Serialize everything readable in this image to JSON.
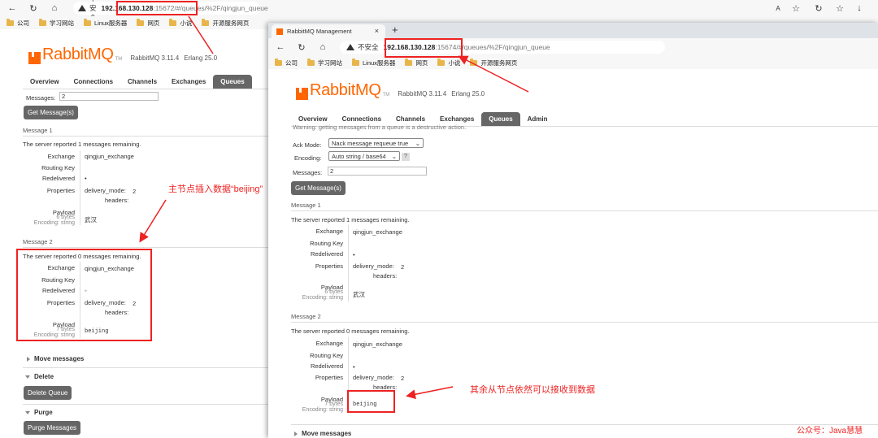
{
  "back_window": {
    "address": {
      "warning": "不安全",
      "host": "192.168.130.128",
      "port": ":15672",
      "path": "/#/queues/%2F/qingjun_queue"
    },
    "bookmarks": [
      "公司",
      "学习网站",
      "Linux服务器",
      "网页",
      "小说",
      "开源服务网页"
    ],
    "logo": {
      "text": "RabbitMQ",
      "tm": "TM",
      "version": "RabbitMQ 3.11.4",
      "erlang": "Erlang 25.0"
    },
    "tabs": [
      "Overview",
      "Connections",
      "Channels",
      "Exchanges",
      "Queues"
    ],
    "messages_label": "Messages:",
    "messages_value": "2",
    "get_button": "Get Message(s)",
    "message1": {
      "title": "Message 1",
      "reported": "The server reported 1 messages remaining.",
      "exchange_label": "Exchange",
      "exchange": "qingjun_exchange",
      "routing_label": "Routing Key",
      "redelivered_label": "Redelivered",
      "redelivered": "•",
      "properties_label": "Properties",
      "delivery_mode_label": "delivery_mode:",
      "delivery_mode": "2",
      "headers_label": "headers:",
      "payload_label": "Payload",
      "payload_bytes": "6 bytes",
      "payload_encoding": "Encoding: string",
      "payload": "武汉"
    },
    "message2": {
      "title": "Message 2",
      "reported": "The server reported 0 messages remaining.",
      "exchange_label": "Exchange",
      "exchange": "qingjun_exchange",
      "routing_label": "Routing Key",
      "redelivered_label": "Redelivered",
      "redelivered": "◦",
      "properties_label": "Properties",
      "delivery_mode_label": "delivery_mode:",
      "delivery_mode": "2",
      "headers_label": "headers:",
      "payload_label": "Payload",
      "payload_bytes": "7 bytes",
      "payload_encoding": "Encoding: string",
      "payload": "beijing"
    },
    "move_messages": "Move messages",
    "delete": "Delete",
    "delete_queue": "Delete Queue",
    "purge": "Purge",
    "purge_messages": "Purge Messages"
  },
  "front_window": {
    "tab_title": "RabbitMQ Management",
    "address": {
      "warning": "不安全",
      "host": "192.168.130.128",
      "port": ":15674",
      "path": "/#/queues/%2F/qingjun_queue"
    },
    "bookmarks": [
      "公司",
      "学习网站",
      "Linux服务器",
      "网页",
      "小说",
      "开源服务网页"
    ],
    "logo": {
      "text": "RabbitMQ",
      "tm": "TM",
      "version": "RabbitMQ 3.11.4",
      "erlang": "Erlang 25.0"
    },
    "tabs": [
      "Overview",
      "Connections",
      "Channels",
      "Exchanges",
      "Queues",
      "Admin"
    ],
    "warning_text": "Warning: getting messages from a queue is a destructive action.",
    "ack_label": "Ack Mode:",
    "ack_value": "Nack message requeue true",
    "encoding_label": "Encoding:",
    "encoding_value": "Auto string / base64",
    "messages_label": "Messages:",
    "messages_value": "2",
    "get_button": "Get Message(s)",
    "message1": {
      "title": "Message 1",
      "reported": "The server reported 1 messages remaining.",
      "exchange_label": "Exchange",
      "exchange": "qingjun_exchange",
      "routing_label": "Routing Key",
      "redelivered_label": "Redelivered",
      "redelivered": "•",
      "properties_label": "Properties",
      "delivery_mode_label": "delivery_mode:",
      "delivery_mode": "2",
      "headers_label": "headers:",
      "payload_label": "Payload",
      "payload_bytes": "6 bytes",
      "payload_encoding": "Encoding: string",
      "payload": "武汉"
    },
    "message2": {
      "title": "Message 2",
      "reported": "The server reported 0 messages remaining.",
      "exchange_label": "Exchange",
      "exchange": "qingjun_exchange",
      "routing_label": "Routing Key",
      "redelivered_label": "Redelivered",
      "redelivered": "•",
      "properties_label": "Properties",
      "delivery_mode_label": "delivery_mode:",
      "delivery_mode": "2",
      "headers_label": "headers:",
      "payload_label": "Payload",
      "payload_bytes": "7 bytes",
      "payload_encoding": "Encoding: string",
      "payload": "beijing"
    },
    "move_messages": "Move messages"
  },
  "annotations": {
    "main_node": "主节点插入数据“beijing”",
    "other_nodes": "其余从节点依然可以接收到数据",
    "watermark": "公众号：Java慧慧"
  },
  "colors": {
    "brand": "#ff6600",
    "annotation": "#ee2222",
    "button": "#666666"
  }
}
